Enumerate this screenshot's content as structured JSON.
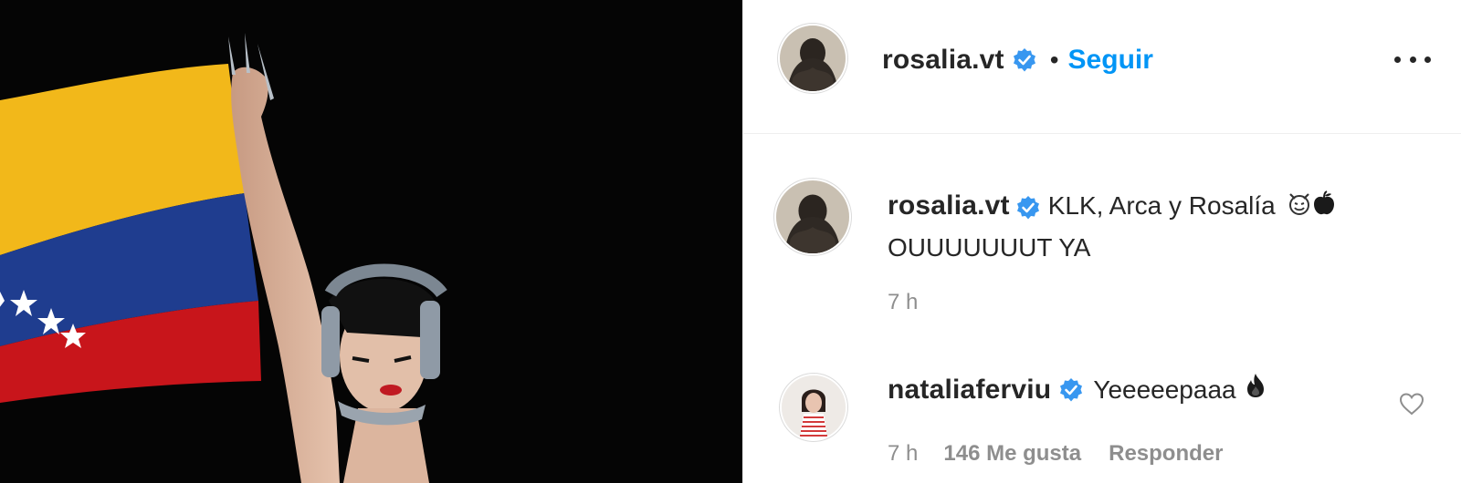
{
  "post": {
    "author": "rosalia.vt",
    "follow_separator": "•",
    "follow_label": "Seguir",
    "more_icon": "more-options-icon",
    "verified_icon": "verified-badge-icon",
    "caption_line1": "KLK, Arca y Rosalía",
    "caption_line2": "OUUUUUUUT YA",
    "caption_emojis": [
      "smiling-imp",
      "black-apple"
    ],
    "caption_time": "7 h"
  },
  "comment": {
    "author": "nataliaferviu",
    "text": "Yeeeeepaaa",
    "emoji": "flame",
    "time": "7 h",
    "likes": "146 Me gusta",
    "reply_label": "Responder"
  },
  "colors": {
    "link_blue": "#0095f6",
    "verified_blue": "#3897f0",
    "muted_text": "#8e8e8e",
    "flag_yellow": "#f2b81a",
    "flag_blue": "#1f3d8f",
    "flag_red": "#c8151b"
  }
}
